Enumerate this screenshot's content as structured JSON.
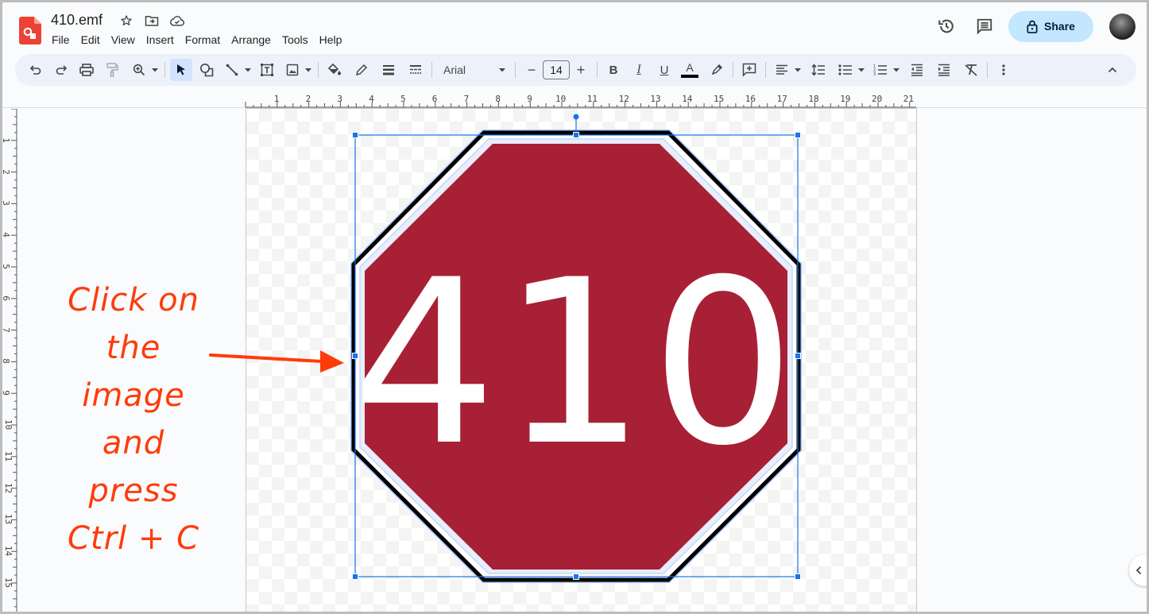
{
  "app": {
    "doc_title": "410.emf",
    "brand_color": "#ea4335",
    "title_icons": [
      "star-icon",
      "move-to-folder-icon",
      "cloud-saved-icon"
    ]
  },
  "menu": [
    "File",
    "Edit",
    "View",
    "Insert",
    "Format",
    "Arrange",
    "Tools",
    "Help"
  ],
  "header_actions": {
    "history_icon": "version-history-icon",
    "comments_icon": "comments-icon",
    "share_label": "Share",
    "share_icon": "lock-icon",
    "share_color": "#c2e7ff"
  },
  "toolbar": {
    "buttons": [
      "undo",
      "redo",
      "print",
      "paint-format",
      "zoom",
      "select",
      "shape",
      "line",
      "text-box",
      "image",
      "fill-color",
      "border-color",
      "border-weight",
      "border-dash"
    ],
    "font": "Arial",
    "font_size": "14",
    "decrease_label": "−",
    "increase_label": "+",
    "format_buttons": [
      "bold",
      "italic",
      "underline",
      "text-color",
      "highlight-color",
      "insert-comment",
      "align",
      "line-spacing",
      "bulleted-list",
      "numbered-list",
      "decrease-indent",
      "increase-indent",
      "clear-formatting",
      "more"
    ],
    "bold_glyph": "B",
    "italic_glyph": "I",
    "underline_glyph": "U",
    "textcolor_glyph": "A"
  },
  "rulers": {
    "horizontal": [
      "1",
      "2",
      "3",
      "4",
      "5",
      "6",
      "7",
      "8",
      "9",
      "10",
      "11",
      "12",
      "13",
      "14",
      "15",
      "16",
      "17",
      "18",
      "19",
      "20",
      "21"
    ],
    "vertical": [
      "1",
      "2",
      "3",
      "4",
      "5",
      "6",
      "7",
      "8",
      "9",
      "10",
      "11",
      "12",
      "13",
      "14",
      "15"
    ]
  },
  "canvas": {
    "sign_text": "410",
    "sign_fill": "#a82035",
    "sign_border": "#000000",
    "selection_color": "#1a73e8",
    "selected": true
  },
  "annotation": {
    "lines": [
      "Click on",
      "the image",
      "and press",
      "Ctrl + C"
    ],
    "color": "#ff3b0a"
  }
}
